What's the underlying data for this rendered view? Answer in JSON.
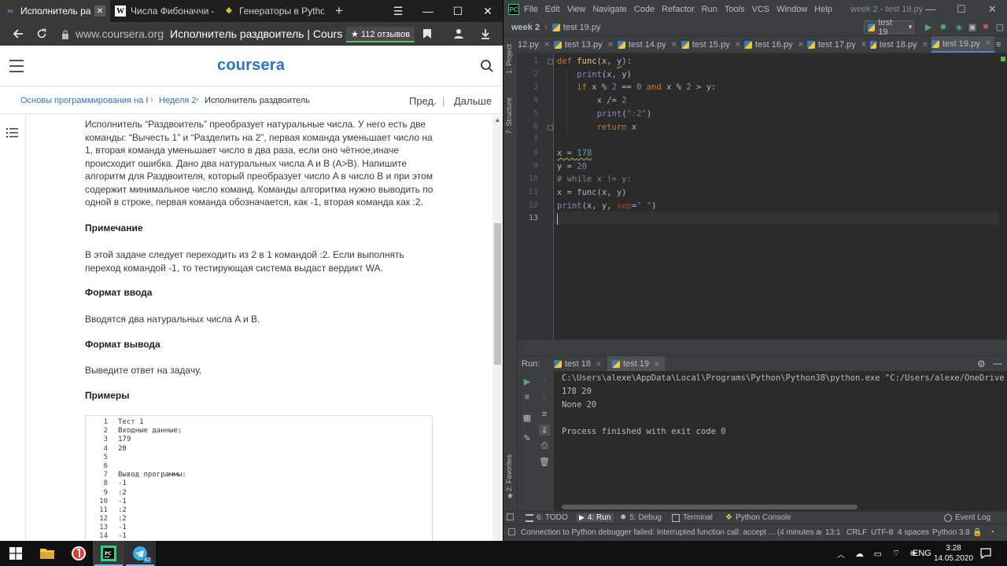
{
  "browser": {
    "tabs": [
      {
        "label": "Исполнитель раздвоитель",
        "favicon": "coursera-icon",
        "active": true
      },
      {
        "label": "Числа Фибоначчи — Википедия",
        "favicon": "wikipedia-icon",
        "active": false
      },
      {
        "label": "Генераторы в Python",
        "favicon": "python-icon",
        "active": false
      }
    ],
    "new_tab": "+",
    "window_controls": {
      "menu": "☰",
      "minimize": "—",
      "maximize": "☐",
      "close": "✕"
    },
    "address_host": "www.coursera.org",
    "address_title": "Исполнитель раздвоитель | Coursera",
    "reviews_badge": "★ 112 отзывов"
  },
  "coursera": {
    "logo": "coursera",
    "breadcrumbs": [
      {
        "label": "Основы программирования на Python",
        "link": true
      },
      {
        "label": "Неделя 2",
        "link": true
      },
      {
        "label": "Исполнитель раздвоитель",
        "link": false
      }
    ],
    "prev": "Пред.",
    "next": "Дальше",
    "intro_lines": [
      "Исполнитель “Раздвоитель” преобразует натуральные числа. У него есть две",
      "команды: “Вычесть 1” и “Разделить на 2”, первая команда уменьшает число на",
      "1, вторая команда уменьшает число в два раза, если оно чётное,иначе",
      "происходит ошибка. Дано два натуральных числа A и B (A>B). Напишите",
      "алгоритм для Раздвоителя, который преобразует число A в число B и при этом",
      "содержит минимальное число команд. Команды алгоритма нужно выводить по",
      "одной в строке, первая команда обозначается, как -1, вторая команда как :2."
    ],
    "note_heading": "Примечание",
    "note_lines": [
      "В этой задаче следует переходить из 2 в 1 командой :2. Если выполнять",
      "переход командой -1, то тестирующая система выдаст вердикт WA."
    ],
    "input_heading": "Формат ввода",
    "input_text": "Вводятся два натуральных числа A и B.",
    "output_heading": "Формат вывода",
    "output_text": "Выведите ответ на задачу.",
    "examples_heading": "Примеры",
    "example_lines": [
      {
        "n": "1",
        "t": "Тест 1"
      },
      {
        "n": "2",
        "t": "Входные данные:"
      },
      {
        "n": "3",
        "t": "179"
      },
      {
        "n": "4",
        "t": "20"
      },
      {
        "n": "5",
        "t": ""
      },
      {
        "n": "6",
        "t": ""
      },
      {
        "n": "7",
        "t": "Вывод программы:"
      },
      {
        "n": "8",
        "t": "-1"
      },
      {
        "n": "9",
        "t": ":2"
      },
      {
        "n": "10",
        "t": "-1"
      },
      {
        "n": "11",
        "t": ":2"
      },
      {
        "n": "12",
        "t": ":2"
      },
      {
        "n": "13",
        "t": "-1"
      },
      {
        "n": "14",
        "t": "-1"
      }
    ]
  },
  "ide": {
    "menu": [
      "File",
      "Edit",
      "View",
      "Navigate",
      "Code",
      "Refactor",
      "Run",
      "Tools",
      "VCS",
      "Window",
      "Help"
    ],
    "window_title": "week 2 - test 19.py",
    "project": "week 2",
    "file": "test 19.py",
    "run_config": "test 19",
    "side_labels": {
      "project": "1: Project",
      "structure": "7: Structure",
      "favorites": "2: Favorites"
    },
    "file_tabs": [
      "12.py",
      "test 13.py",
      "test 14.py",
      "test 15.py",
      "test 16.py",
      "test 17.py",
      "test 18.py",
      "test 19.py"
    ],
    "active_file_tab": 7,
    "line_numbers": [
      "1",
      "2",
      "3",
      "4",
      "5",
      "6",
      "7",
      "8",
      "9",
      "10",
      "11",
      "12",
      "13"
    ],
    "current_line": 13,
    "code": [
      [
        {
          "c": "kw",
          "t": "def "
        },
        {
          "c": "fn",
          "t": "func"
        },
        {
          "c": "",
          "t": "(x, "
        },
        {
          "c": "squig",
          "t": "y"
        },
        {
          "c": "",
          "t": "):"
        }
      ],
      [
        {
          "c": "",
          "t": "    "
        },
        {
          "c": "bi",
          "t": "print"
        },
        {
          "c": "",
          "t": "(x, y)"
        }
      ],
      [
        {
          "c": "",
          "t": "    "
        },
        {
          "c": "kw",
          "t": "if "
        },
        {
          "c": "",
          "t": "x % "
        },
        {
          "c": "num",
          "t": "2"
        },
        {
          "c": "",
          "t": " == "
        },
        {
          "c": "num",
          "t": "0"
        },
        {
          "c": "kw",
          "t": " and "
        },
        {
          "c": "",
          "t": "x % "
        },
        {
          "c": "num",
          "t": "2"
        },
        {
          "c": "",
          "t": " > y:"
        }
      ],
      [
        {
          "c": "",
          "t": "        x /= "
        },
        {
          "c": "num",
          "t": "2"
        }
      ],
      [
        {
          "c": "",
          "t": "        "
        },
        {
          "c": "bi",
          "t": "print"
        },
        {
          "c": "",
          "t": "("
        },
        {
          "c": "str",
          "t": "\":2\""
        },
        {
          "c": "",
          "t": ")"
        }
      ],
      [
        {
          "c": "",
          "t": "        "
        },
        {
          "c": "kw",
          "t": "return "
        },
        {
          "c": "",
          "t": "x"
        }
      ],
      [],
      [
        {
          "c": "squig",
          "t": "x = "
        },
        {
          "c": "num squig",
          "t": "178"
        }
      ],
      [
        {
          "c": "",
          "t": "y = "
        },
        {
          "c": "num",
          "t": "20"
        }
      ],
      [
        {
          "c": "cm",
          "t": "# while x != y:"
        }
      ],
      [
        {
          "c": "",
          "t": "x = func(x, y)"
        }
      ],
      [
        {
          "c": "bi",
          "t": "print"
        },
        {
          "c": "",
          "t": "(x, y, "
        },
        {
          "c": "kwarg",
          "t": "sep"
        },
        {
          "c": "",
          "t": "="
        },
        {
          "c": "str",
          "t": "\" \""
        },
        {
          "c": "",
          "t": ")"
        }
      ],
      []
    ],
    "run_label": "Run:",
    "run_tabs": [
      "test 18",
      "test 19"
    ],
    "console": [
      "C:\\Users\\alexe\\AppData\\Local\\Programs\\Python\\Python38\\python.exe \"C:/Users/alexe/OneDrive",
      "178 20",
      "None 20",
      "",
      "Process finished with exit code 0"
    ],
    "tool_windows": [
      "6: TODO",
      "4: Run",
      "5: Debug",
      "Terminal",
      "Python Console",
      "Event Log"
    ],
    "status": {
      "message": "Connection to Python debugger failed: Interrupted function call: accept ... (4 minutes ago)",
      "position": "13:1",
      "line_sep": "CRLF",
      "encoding": "UTF-8",
      "indent": "4 spaces",
      "interpreter": "Python 3.8"
    }
  },
  "taskbar": {
    "apps": [
      "start-icon",
      "explorer-icon",
      "yandex-browser-icon",
      "pycharm-icon",
      "telegram-icon"
    ],
    "telegram_badge": "42",
    "lang": "ENG",
    "time": "3:28",
    "date": "14.05.2020"
  },
  "colors": {
    "coursera_blue": "#2a73cc",
    "ide_bg": "#2b2b2b",
    "keyword": "#cc7832",
    "function": "#ffc66d",
    "number": "#6897bb",
    "string": "#6a8759"
  }
}
